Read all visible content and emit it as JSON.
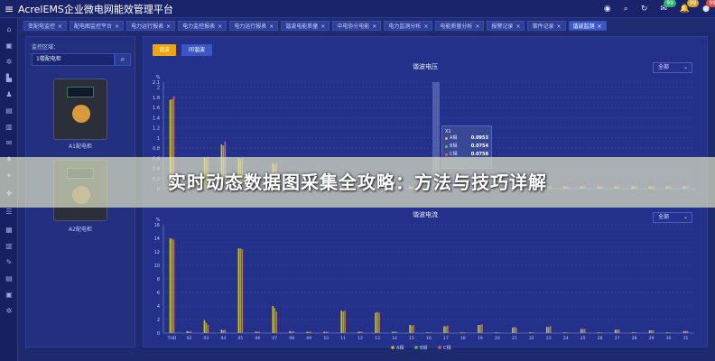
{
  "header": {
    "menu_icon": "≡",
    "title": "AcrelEMS企业微电网能效管理平台",
    "icons": [
      {
        "name": "monitor-icon",
        "glyph": "◉"
      },
      {
        "name": "search-icon",
        "glyph": "⌕"
      },
      {
        "name": "refresh-icon",
        "glyph": "↻"
      },
      {
        "name": "message-icon",
        "glyph": "✉",
        "badge": "99",
        "badge_color": "#29b36b"
      },
      {
        "name": "bell-icon",
        "glyph": "🔔",
        "badge": "99",
        "badge_color": "#e2a11e"
      },
      {
        "name": "user-icon",
        "glyph": "●",
        "badge": "99",
        "badge_color": "#d94a4a"
      }
    ]
  },
  "tabs": [
    {
      "label": "变配电监控",
      "active": false
    },
    {
      "label": "配电图监控平台",
      "active": false
    },
    {
      "label": "电力运行报表",
      "active": false
    },
    {
      "label": "电力监控报表",
      "active": false
    },
    {
      "label": "电力运行报表",
      "active": false
    },
    {
      "label": "谐波电能质量",
      "active": false
    },
    {
      "label": "中电协分电能",
      "active": false
    },
    {
      "label": "电力监测分析",
      "active": false
    },
    {
      "label": "电能质量分析",
      "active": false
    },
    {
      "label": "报警记录",
      "active": false
    },
    {
      "label": "事件记录",
      "active": false
    },
    {
      "label": "谐波监测",
      "active": true
    }
  ],
  "left_panel": {
    "label": "监控区域：",
    "input_value": "1楼配电柜",
    "devices": [
      {
        "label": "A1配电柜"
      },
      {
        "label": "A2配电柜"
      }
    ]
  },
  "controls": {
    "btn1": "谐波",
    "btn2": "间谐波"
  },
  "colors": {
    "accent": "#f0a500",
    "phaseA": "#e6b422",
    "phaseB": "#5cc24a",
    "phaseC": "#e05a6a"
  },
  "banner": "实时动态数据图采集全攻略：方法与技巧详解",
  "tooltip": {
    "title": "X1",
    "rows": [
      {
        "label": "A相",
        "value": "0.0953",
        "color": "#e6b422"
      },
      {
        "label": "B相",
        "value": "0.0754",
        "color": "#5cc24a"
      },
      {
        "label": "C相",
        "value": "0.0758",
        "color": "#e05a6a"
      }
    ]
  },
  "chart_data": [
    {
      "type": "bar",
      "title": "谐波电压",
      "ylabel": "%",
      "select": "全部",
      "ylim": [
        0,
        2.1
      ],
      "yticks": [
        "0",
        "0.2",
        "0.4",
        "0.6",
        "0.8",
        "1",
        "1.2",
        "1.4",
        "1.6",
        "1.8",
        "2",
        "2.1"
      ],
      "series": [
        {
          "name": "A相",
          "color": "#e6b422",
          "values": [
            1.75,
            0.05,
            0.62,
            0.87,
            0.6,
            0.07,
            0.5,
            0.05,
            0.05,
            0.05,
            0.05,
            0.05,
            0.05,
            0.05,
            0.05,
            0.05,
            0.05,
            0.05,
            0.05,
            0.05,
            0.05,
            0.05,
            0.05,
            0.05,
            0.05,
            0.05,
            0.05,
            0.05,
            0.05,
            0.05,
            0.05
          ]
        },
        {
          "name": "B相",
          "color": "#5cc24a",
          "values": [
            1.76,
            0.04,
            0.6,
            0.85,
            0.58,
            0.06,
            0.48,
            0.04,
            0.04,
            0.04,
            0.04,
            0.04,
            0.04,
            0.04,
            0.04,
            0.04,
            0.04,
            0.04,
            0.04,
            0.04,
            0.04,
            0.04,
            0.04,
            0.04,
            0.04,
            0.04,
            0.04,
            0.04,
            0.04,
            0.04,
            0.04
          ]
        },
        {
          "name": "C相",
          "color": "#e05a6a",
          "values": [
            1.82,
            0.05,
            0.63,
            0.93,
            0.6,
            0.07,
            0.5,
            0.05,
            0.05,
            0.05,
            0.05,
            0.05,
            0.05,
            0.05,
            0.05,
            0.05,
            0.05,
            0.05,
            0.05,
            0.05,
            0.05,
            0.05,
            0.05,
            0.05,
            0.05,
            0.05,
            0.05,
            0.05,
            0.05,
            0.05,
            0.05
          ]
        }
      ]
    },
    {
      "type": "bar",
      "title": "谐波电流",
      "ylabel": "%",
      "select": "全部",
      "ylim": [
        0,
        16
      ],
      "yticks": [
        "0",
        "2",
        "4",
        "6",
        "8",
        "10",
        "12",
        "14",
        "16"
      ],
      "categories": [
        "THD",
        "02",
        "03",
        "04",
        "05",
        "06",
        "07",
        "08",
        "09",
        "10",
        "11",
        "12",
        "13",
        "14",
        "15",
        "16",
        "17",
        "18",
        "19",
        "20",
        "21",
        "22",
        "23",
        "24",
        "25",
        "26",
        "27",
        "28",
        "29",
        "30",
        "31"
      ],
      "series": [
        {
          "name": "A相",
          "color": "#e6b422",
          "values": [
            14.0,
            0.3,
            1.9,
            0.5,
            12.5,
            0.2,
            4.0,
            0.3,
            0.2,
            0.2,
            3.3,
            0.2,
            3.0,
            0.2,
            1.2,
            0.1,
            1.0,
            0.1,
            1.2,
            0.1,
            0.8,
            0.1,
            0.9,
            0.1,
            0.6,
            0.1,
            0.5,
            0.1,
            0.4,
            0.1,
            0.3
          ]
        },
        {
          "name": "B相",
          "color": "#5cc24a",
          "values": [
            13.9,
            0.2,
            1.5,
            0.4,
            12.5,
            0.2,
            3.7,
            0.2,
            0.2,
            0.2,
            3.2,
            0.2,
            3.1,
            0.2,
            1.1,
            0.1,
            1.0,
            0.1,
            1.2,
            0.1,
            0.9,
            0.1,
            0.9,
            0.1,
            0.6,
            0.1,
            0.5,
            0.1,
            0.4,
            0.1,
            0.3
          ]
        },
        {
          "name": "C相",
          "color": "#e05a6a",
          "values": [
            13.8,
            0.3,
            1.2,
            0.5,
            12.4,
            0.2,
            3.2,
            0.3,
            0.2,
            0.2,
            3.3,
            0.2,
            3.0,
            0.2,
            1.2,
            0.1,
            1.1,
            0.1,
            1.3,
            0.1,
            0.8,
            0.1,
            1.0,
            0.1,
            0.6,
            0.1,
            0.5,
            0.1,
            0.4,
            0.1,
            0.3
          ]
        }
      ]
    }
  ]
}
